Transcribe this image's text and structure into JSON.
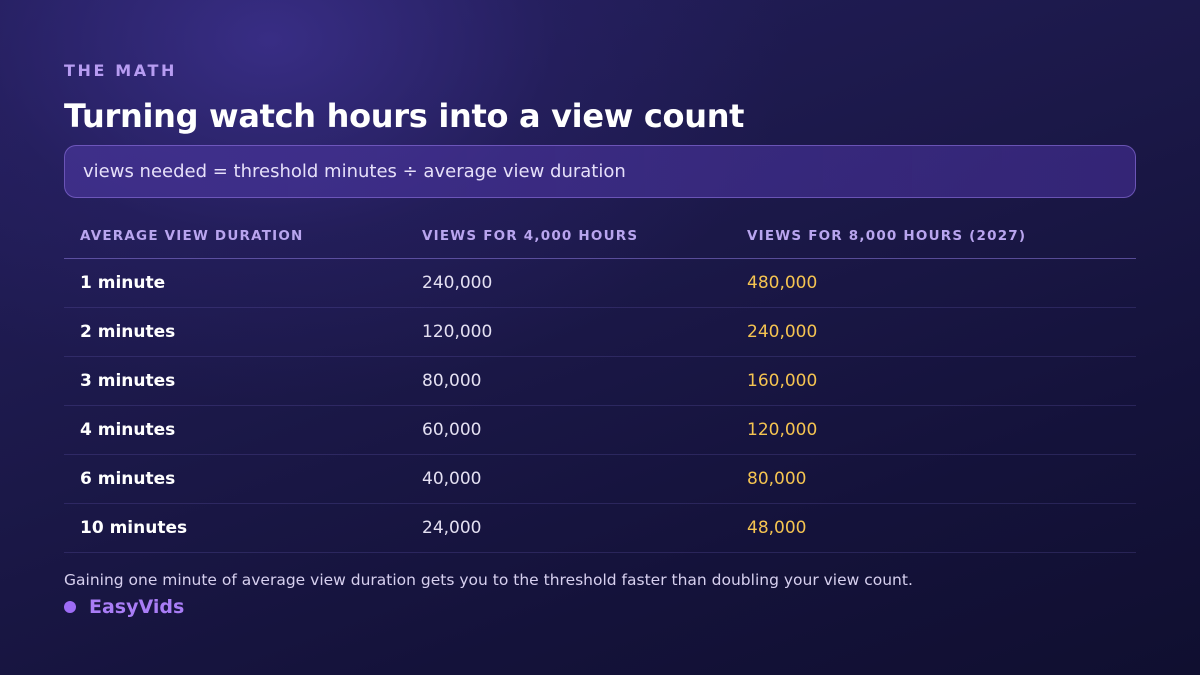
{
  "header": {
    "eyebrow": "THE MATH",
    "title": "Turning watch hours into a view count"
  },
  "formula": "views needed = threshold minutes ÷ average view duration",
  "table": {
    "headers": [
      "AVERAGE VIEW DURATION",
      "VIEWS FOR 4,000 HOURS",
      "VIEWS FOR 8,000 HOURS (2027)"
    ],
    "rows": [
      {
        "duration": "1 minute",
        "views_4000": "240,000",
        "views_8000": "480,000"
      },
      {
        "duration": "2 minutes",
        "views_4000": "120,000",
        "views_8000": "240,000"
      },
      {
        "duration": "3 minutes",
        "views_4000": "80,000",
        "views_8000": "160,000"
      },
      {
        "duration": "4 minutes",
        "views_4000": "60,000",
        "views_8000": "120,000"
      },
      {
        "duration": "6 minutes",
        "views_4000": "40,000",
        "views_8000": "80,000"
      },
      {
        "duration": "10 minutes",
        "views_4000": "24,000",
        "views_8000": "48,000"
      }
    ]
  },
  "footnote": "Gaining one minute of average view duration gets you to the threshold faster than doubling your view count.",
  "brand": {
    "name": "EasyVids",
    "icon": "dot-icon"
  },
  "colors": {
    "accent": "#b79cf2",
    "highlight_values": "#f5c451",
    "brand": "#a97df6"
  }
}
